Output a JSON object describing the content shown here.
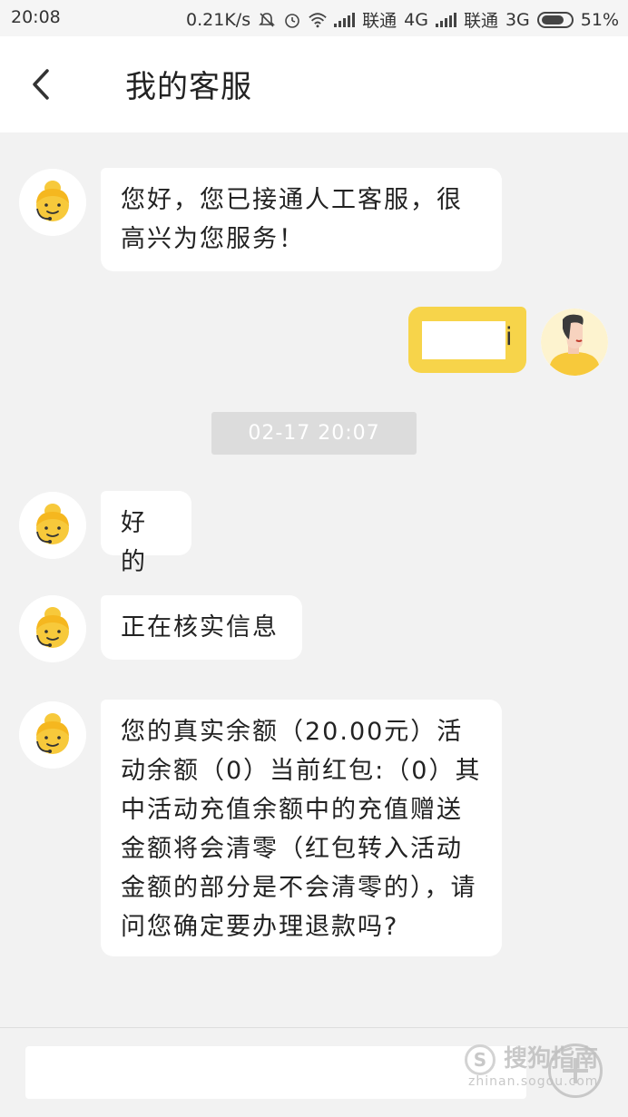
{
  "status_bar": {
    "time": "20:08",
    "speed": "0.21K/s",
    "carrier1": "联通",
    "net1": "4G",
    "carrier2": "联通",
    "net2": "3G",
    "battery": "51%",
    "icons": [
      "mute-icon",
      "alarm-icon",
      "wifi-icon",
      "signal-icon",
      "battery-icon"
    ]
  },
  "header": {
    "title": "我的客服",
    "back_icon": "chevron-left-icon"
  },
  "messages": [
    {
      "sender": "agent",
      "text": "您好，您已接通人工客服，很高兴为您服务！"
    },
    {
      "sender": "user",
      "text": ""
    },
    {
      "sender": "agent",
      "text": "好的"
    },
    {
      "sender": "agent",
      "text": "正在核实信息"
    },
    {
      "sender": "agent",
      "text": "您的真实余额（20.00元）活动余额（0）当前红包:（0）其中活动充值余额中的充值赠送金额将会清零（红包转入活动金额的部分是不会清零的），请问您确定要办理退款吗?"
    }
  ],
  "timestamp": "02-17 20:07",
  "input": {
    "placeholder": ""
  },
  "watermark": {
    "text": "搜狗指南",
    "sub": "zhinan.sogou.com",
    "logo": "S"
  },
  "colors": {
    "accent": "#f7d44a",
    "background": "#f2f2f2",
    "bubble": "#ffffff"
  }
}
